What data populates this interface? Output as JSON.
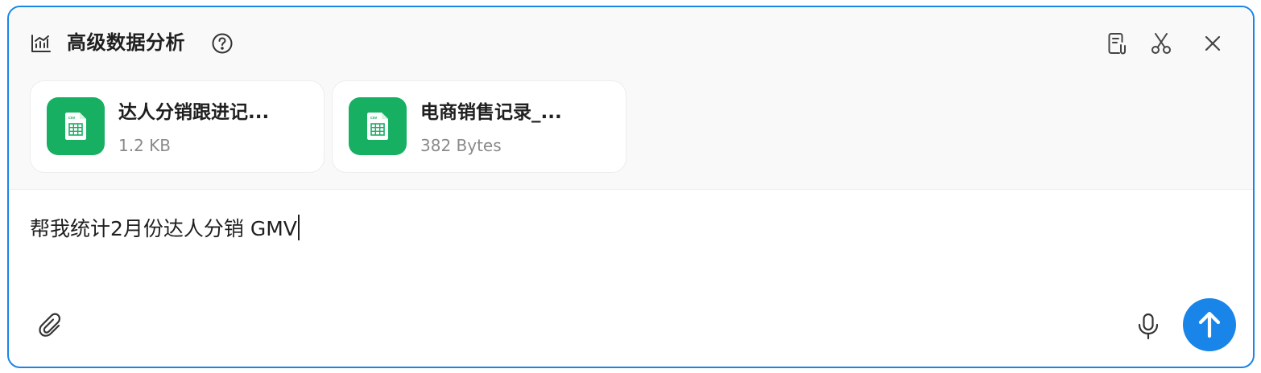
{
  "header": {
    "title": "高级数据分析",
    "icons": [
      "chart-icon",
      "help-icon",
      "clipboard-attach-icon",
      "scissors-icon",
      "close-icon"
    ]
  },
  "files": [
    {
      "name": "达人分销跟进记...",
      "size": "1.2 KB",
      "type_badge": "csv"
    },
    {
      "name": "电商销售记录_...",
      "size": "382 Bytes",
      "type_badge": "csv"
    }
  ],
  "input": {
    "value": "帮我统计2月份达人分销 GMV"
  },
  "footer": {
    "icons": [
      "paperclip-icon",
      "microphone-icon",
      "send-arrow-icon"
    ]
  },
  "colors": {
    "accent": "#1a85e8",
    "file_icon_bg": "#17b063",
    "top_bg": "#f9f9f9"
  }
}
